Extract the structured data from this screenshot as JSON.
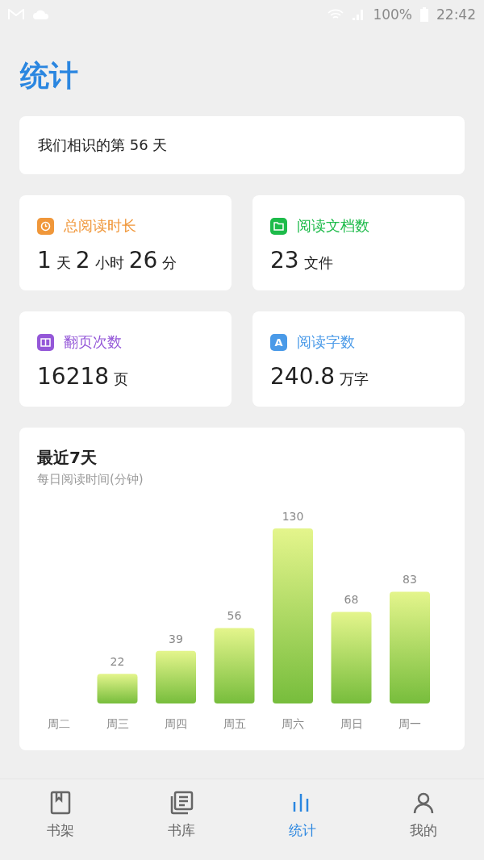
{
  "status_bar": {
    "battery": "100%",
    "time": "22:42"
  },
  "header": {
    "title": "统计"
  },
  "days_card": {
    "text": "我们相识的第 56 天"
  },
  "stats": [
    {
      "kind": "clock",
      "label": "总阅读时长",
      "color": "#f0973a",
      "parts": [
        {
          "text": "1",
          "kind": "number"
        },
        {
          "text": "天",
          "kind": "unit"
        },
        {
          "text": "2",
          "kind": "number"
        },
        {
          "text": "小时",
          "kind": "unit"
        },
        {
          "text": "26",
          "kind": "number"
        },
        {
          "text": "分",
          "kind": "unit"
        }
      ]
    },
    {
      "kind": "folder",
      "label": "阅读文档数",
      "color": "#1dbb4a",
      "parts": [
        {
          "text": "23",
          "kind": "number"
        },
        {
          "text": "文件",
          "kind": "unit"
        }
      ]
    },
    {
      "kind": "book",
      "label": "翻页次数",
      "color": "#9457d8",
      "parts": [
        {
          "text": "16218",
          "kind": "number"
        },
        {
          "text": "页",
          "kind": "unit"
        }
      ]
    },
    {
      "kind": "letter",
      "label": "阅读字数",
      "color": "#4a9ae8",
      "icon_text": "A",
      "parts": [
        {
          "text": "240.8",
          "kind": "number"
        },
        {
          "text": "万字",
          "kind": "unit"
        }
      ]
    }
  ],
  "chart_card": {
    "title": "最近7天",
    "subtitle": "每日阅读时间(分钟)",
    "chart_data": {
      "type": "bar",
      "categories": [
        "周二",
        "周三",
        "周四",
        "周五",
        "周六",
        "周日",
        "周一"
      ],
      "values": [
        null,
        22,
        39,
        56,
        130,
        68,
        83
      ],
      "data_labels": true
    }
  },
  "nav": [
    {
      "kind": "shelf",
      "label": "书架",
      "selected": false
    },
    {
      "kind": "library",
      "label": "书库",
      "selected": false
    },
    {
      "kind": "stats",
      "label": "统计",
      "selected": true
    },
    {
      "kind": "me",
      "label": "我的",
      "selected": false
    }
  ]
}
